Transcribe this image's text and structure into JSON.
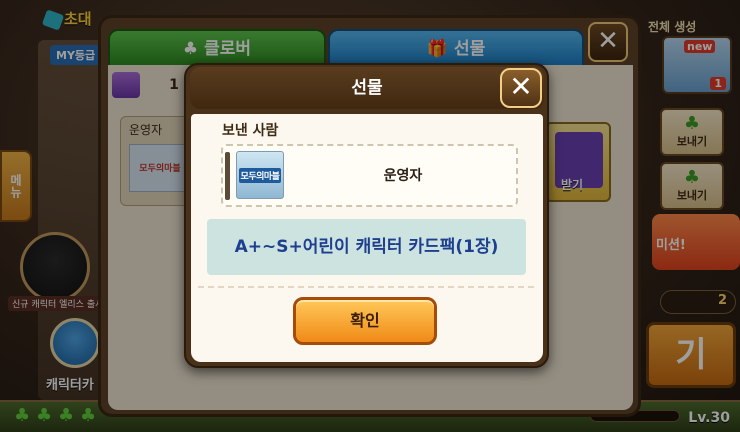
{
  "background": {
    "title": "초대",
    "my_label": "MY등급",
    "side_tab_label": "메뉴",
    "avatar_caption": "신규 캐릭터 엘리스 출시",
    "character_label": "캐릭터카",
    "level": "Lv.30",
    "right_header": "전체 생성",
    "mail_new_badge": "new",
    "mail_count": "1",
    "send_label_1": "보내기",
    "send_label_2": "보내기",
    "event_label": "미션!",
    "key_count": "2",
    "big_button_label": "기"
  },
  "gift_window": {
    "tabs": [
      {
        "label": "클로버",
        "icon": "clover-icon"
      },
      {
        "label": "선물",
        "icon": "gift-icon"
      }
    ],
    "close_label": "✕",
    "gift_count": "1",
    "card_sender": "운영자",
    "card_logo": "모두의마블",
    "right_card_label": "받기"
  },
  "modal": {
    "title": "선물",
    "close_label": "✕",
    "sender_label": "보낸 사람",
    "sender_logo": "모두의마블",
    "sender_name": "운영자",
    "item_name": "A+~S+어린이 캐릭터 카드팩(1장)",
    "confirm_label": "확인"
  },
  "colors": {
    "tab_clover": "#3aa52b",
    "tab_gift": "#2b8fd6",
    "item_text": "#1e3f8f",
    "confirm_button": "#f5a128"
  }
}
